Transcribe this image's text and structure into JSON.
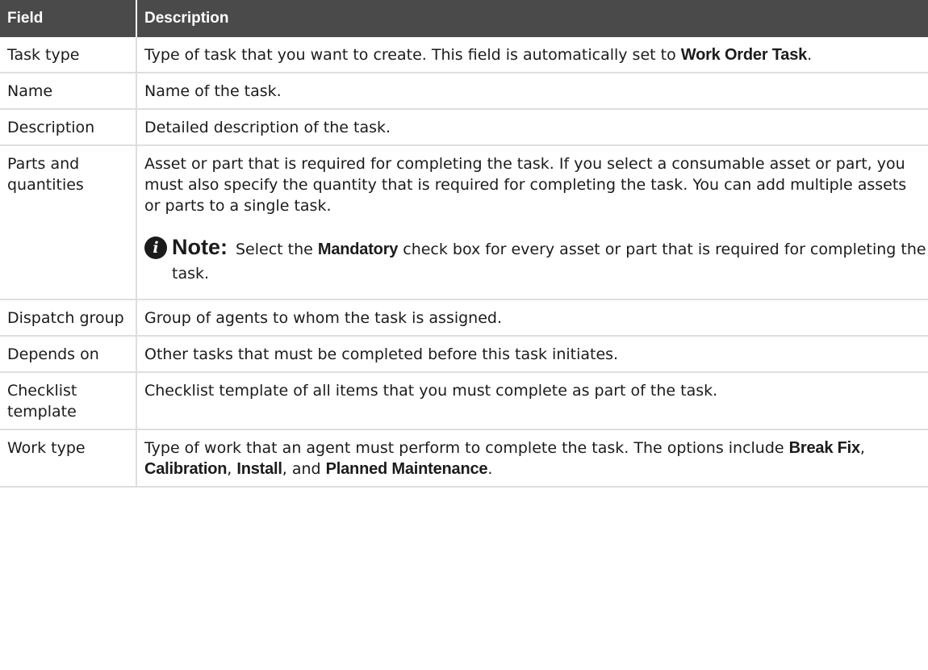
{
  "table": {
    "headers": {
      "field": "Field",
      "description": "Description"
    },
    "rows": [
      {
        "field": "Task type",
        "desc_parts": [
          "Type of task that you want to create. This field is automatically set to ",
          "Work Order Task",
          "."
        ]
      },
      {
        "field": "Name",
        "description": "Name of the task."
      },
      {
        "field": "Description",
        "description": "Detailed description of the task."
      },
      {
        "field": "Parts and quantities",
        "description": "Asset or part that is required for completing the task. If you select a consumable asset or part, you must also specify the quantity that is required for completing the task. You can add multiple assets or parts to a single task.",
        "note": {
          "icon": "info-icon",
          "title": "Note:",
          "parts": [
            "Select the ",
            "Mandatory",
            " check box for every asset or part that is required for completing the task."
          ]
        }
      },
      {
        "field": "Dispatch group",
        "description": "Group of agents to whom the task is assigned."
      },
      {
        "field": "Depends on",
        "description": "Other tasks that must be completed before this task initiates."
      },
      {
        "field": "Checklist template",
        "description": "Checklist template of all items that you must complete as part of the task."
      },
      {
        "field": "Work type",
        "desc_parts": [
          "Type of work that an agent must perform to complete the task. The options include ",
          "Break Fix",
          ", ",
          "Calibration",
          ", ",
          "Install",
          ", and ",
          "Planned Maintenance",
          "."
        ]
      }
    ]
  }
}
